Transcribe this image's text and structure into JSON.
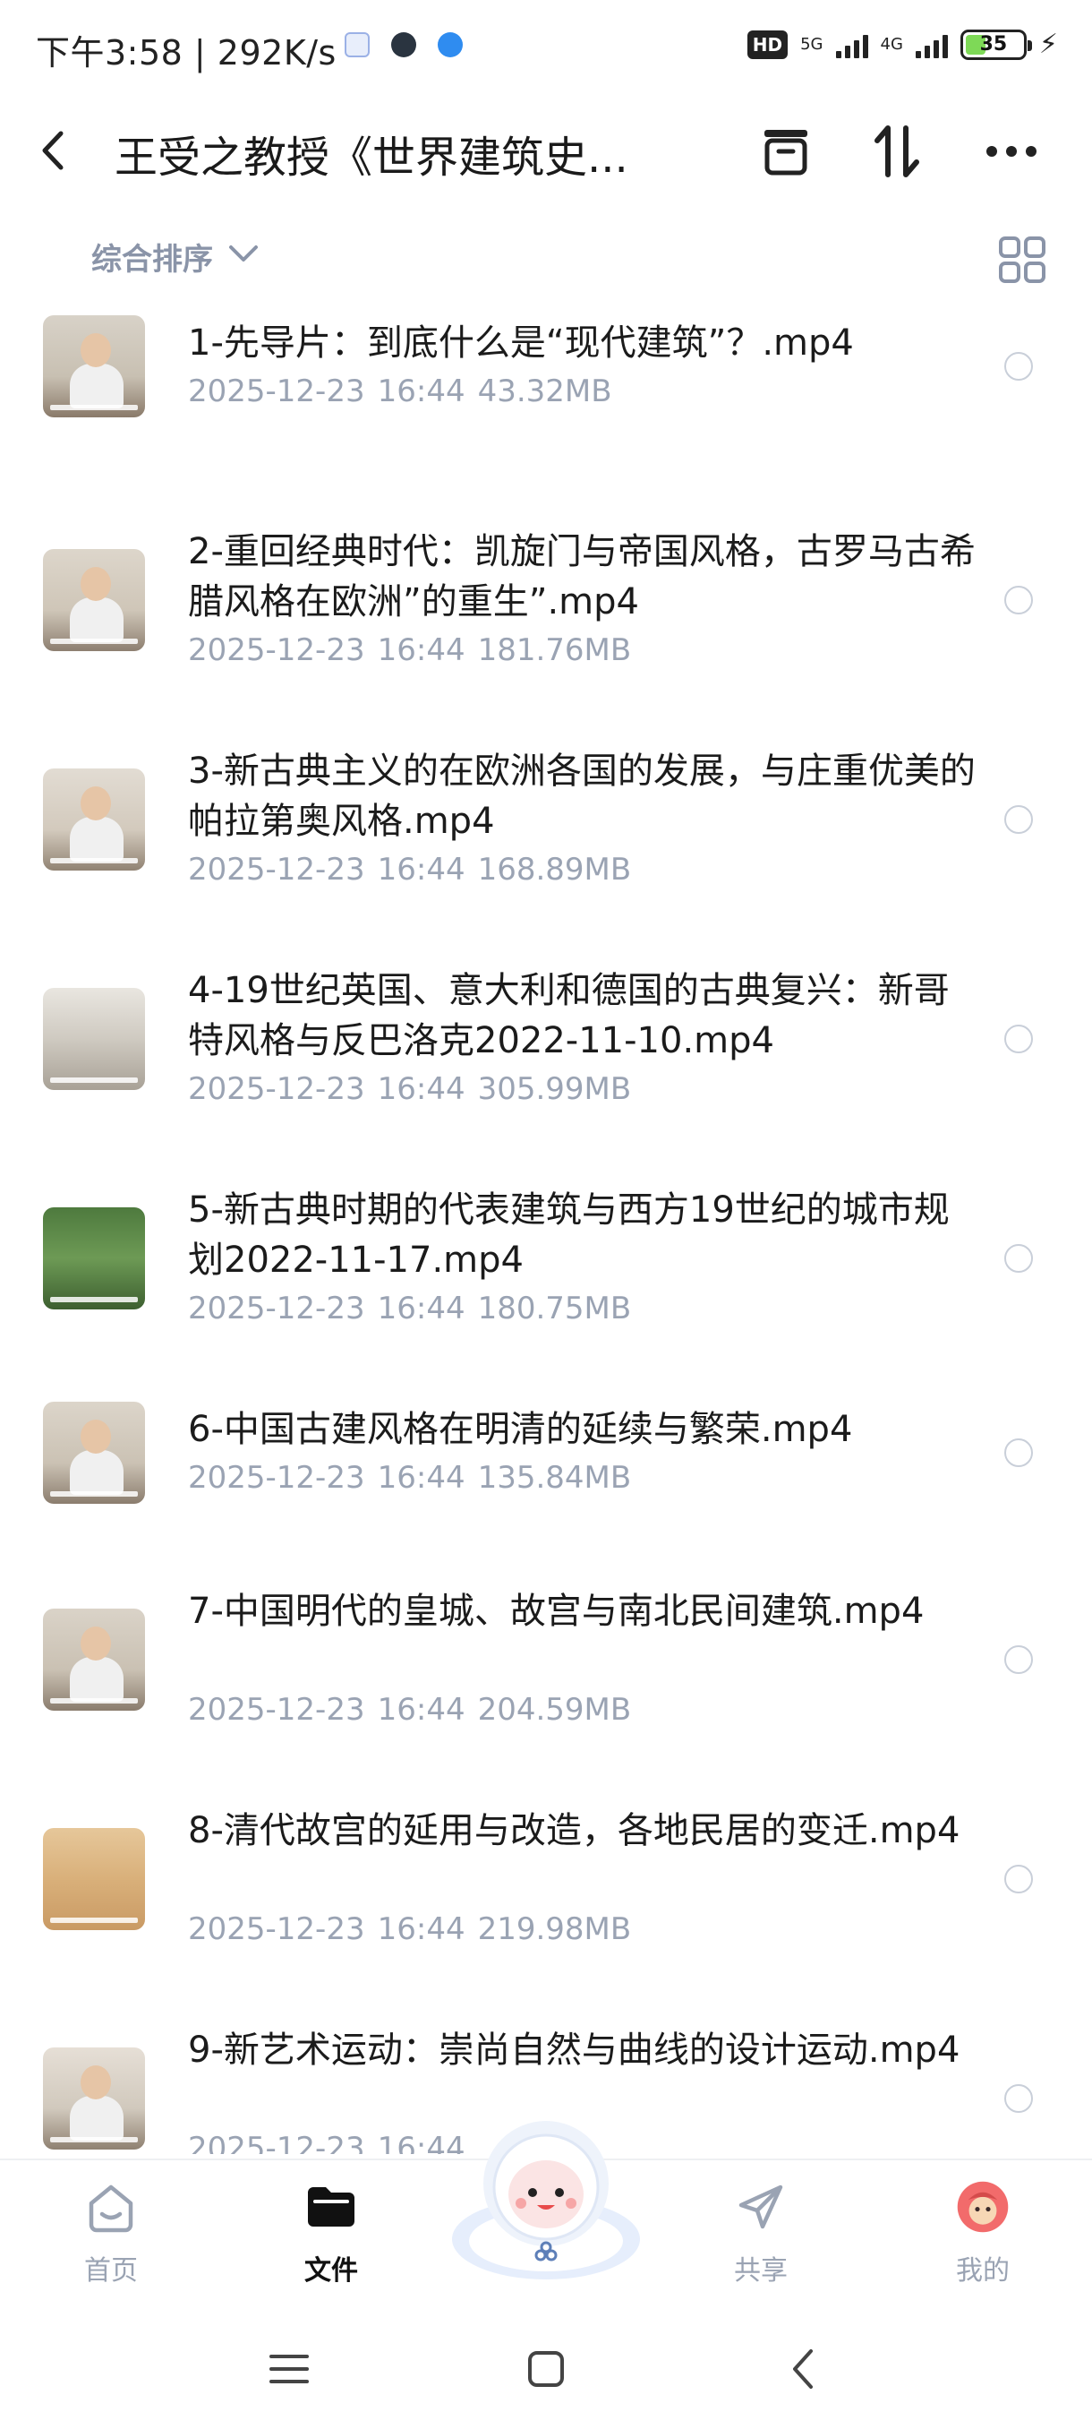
{
  "status_bar": {
    "time": "下午3:58 | 292K/s",
    "hd": "HD",
    "net_1": "5G",
    "net_2": "4G",
    "battery": "35"
  },
  "header": {
    "title": "王受之教授《世界建筑史...",
    "back_icon": "chevron-left-icon",
    "archive_icon": "archive-icon",
    "sort_icon": "sort-arrows-icon",
    "more_icon": "more-dots-icon"
  },
  "toolbar": {
    "sort_label": "综合排序",
    "view_icon": "grid-view-icon"
  },
  "files": [
    {
      "name": "1-先导片：到底什么是“现代建筑”？.mp4",
      "date": "2025-12-23",
      "time": "16:44",
      "size": "43.32MB"
    },
    {
      "name": "2-重回经典时代：凯旋门与帝国风格，古罗马古希腊风格在欧洲”的重生”.mp4",
      "date": "2025-12-23",
      "time": "16:44",
      "size": "181.76MB"
    },
    {
      "name": "3-新古典主义的在欧洲各国的发展，与庄重优美的帕拉第奥风格.mp4",
      "date": "2025-12-23",
      "time": "16:44",
      "size": "168.89MB"
    },
    {
      "name": "4-19世纪英国、意大利和德国的古典复兴：新哥特风格与反巴洛克2022-11-10.mp4",
      "date": "2025-12-23",
      "time": "16:44",
      "size": "305.99MB"
    },
    {
      "name": "5-新古典时期的代表建筑与西方19世纪的城市规划2022-11-17.mp4",
      "date": "2025-12-23",
      "time": "16:44",
      "size": "180.75MB"
    },
    {
      "name": "6-中国古建风格在明清的延续与繁荣.mp4",
      "date": "2025-12-23",
      "time": "16:44",
      "size": "135.84MB"
    },
    {
      "name": "7-中国明代的皇城、故宫与南北民间建筑.mp4",
      "date": "2025-12-23",
      "time": "16:44",
      "size": "204.59MB"
    },
    {
      "name": "8-清代故宫的延用与改造，各地民居的变迁.mp4",
      "date": "2025-12-23",
      "time": "16:44",
      "size": "219.98MB"
    },
    {
      "name": "9-新艺术运动：崇尚自然与曲线的设计运动.mp4",
      "date": "2025-12-23",
      "time": "16:44",
      "size": ""
    }
  ],
  "tabs": [
    {
      "label": "首页",
      "icon": "home-icon"
    },
    {
      "label": "文件",
      "icon": "folder-icon"
    },
    {
      "label": "",
      "icon": "mascot-icon"
    },
    {
      "label": "共享",
      "icon": "send-icon"
    },
    {
      "label": "我的",
      "icon": "avatar-icon"
    }
  ],
  "colors": {
    "accent_text": "#8a94a8",
    "meta_text": "#9aa3b3",
    "battery_fill": "#7ed957"
  }
}
